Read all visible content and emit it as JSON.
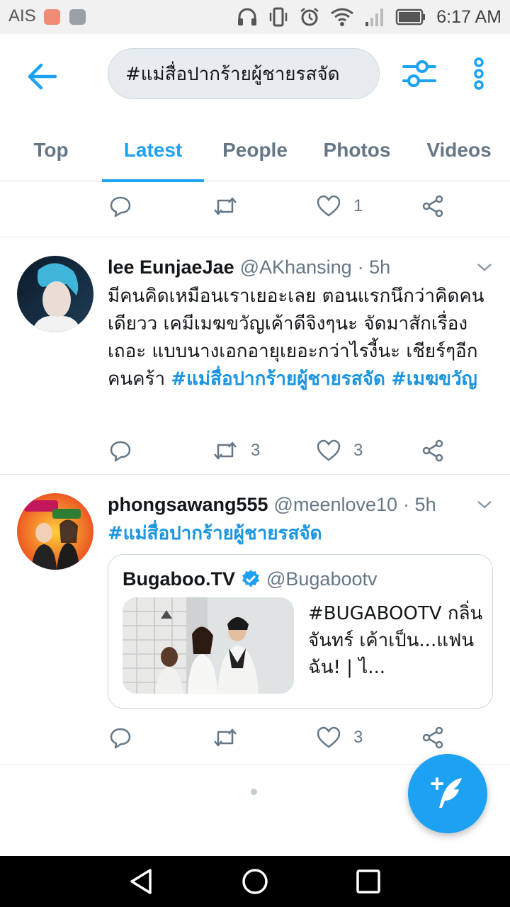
{
  "status_bar": {
    "carrier": "AIS",
    "time": "6:17 AM",
    "icons": [
      "mail-app-icon",
      "gallery-app-icon",
      "headphones-icon",
      "vibrate-icon",
      "alarm-icon",
      "wifi-icon",
      "signal-icon",
      "battery-icon"
    ]
  },
  "header": {
    "search_query": "#แม่สื่อปากร้ายผู้ชายรสจัด",
    "icons": [
      "back-arrow-icon",
      "filter-sliders-icon",
      "more-vertical-icon"
    ]
  },
  "tabs": [
    {
      "label": "Top",
      "active": false
    },
    {
      "label": "Latest",
      "active": true
    },
    {
      "label": "People",
      "active": false
    },
    {
      "label": "Photos",
      "active": false
    },
    {
      "label": "Videos",
      "active": false
    }
  ],
  "partial_tweet": {
    "reply_count": "",
    "retweet_count": "",
    "like_count": "1"
  },
  "tweets": [
    {
      "name": "lee EunjaeJae",
      "handle": "@AKhansing",
      "time": "· 5h",
      "text": "มีคนคิดเหมือนเราเยอะเลย ตอนแรกนึกว่าคิดคนเดียวว เคมีเมฆขวัญเค้าดีจิงๆนะ จัดมาสักเรื่องเถอะ แบบนางเอกอายุเยอะกว่าไรงี้นะ เชียร์ๆอีกคนคร้า ",
      "hashtags": [
        "#แม่สื่อปากร้ายผู้ชายรสจัด",
        "#เมฆขวัญ"
      ],
      "reply_count": "",
      "retweet_count": "3",
      "like_count": "3"
    },
    {
      "name": "phongsawang555",
      "handle": "@meenlove10",
      "time": "· 5h",
      "hashtags": [
        "#แม่สื่อปากร้ายผู้ชายรสจัด"
      ],
      "card": {
        "account_name": "Bugaboo.TV",
        "account_handle": "@Bugabootv",
        "verified": true,
        "title": "#BUGABOOTV กลิ่นจันทร์ เค้าเป็น...แฟนฉัน! | ไ..."
      },
      "reply_count": "",
      "retweet_count": "",
      "like_count": "3"
    }
  ],
  "fab": {
    "icon": "compose-tweet-icon"
  },
  "colors": {
    "accent": "#1da1f2",
    "hashtag": "#1b95e0",
    "muted": "#657786",
    "text": "#14171a"
  }
}
